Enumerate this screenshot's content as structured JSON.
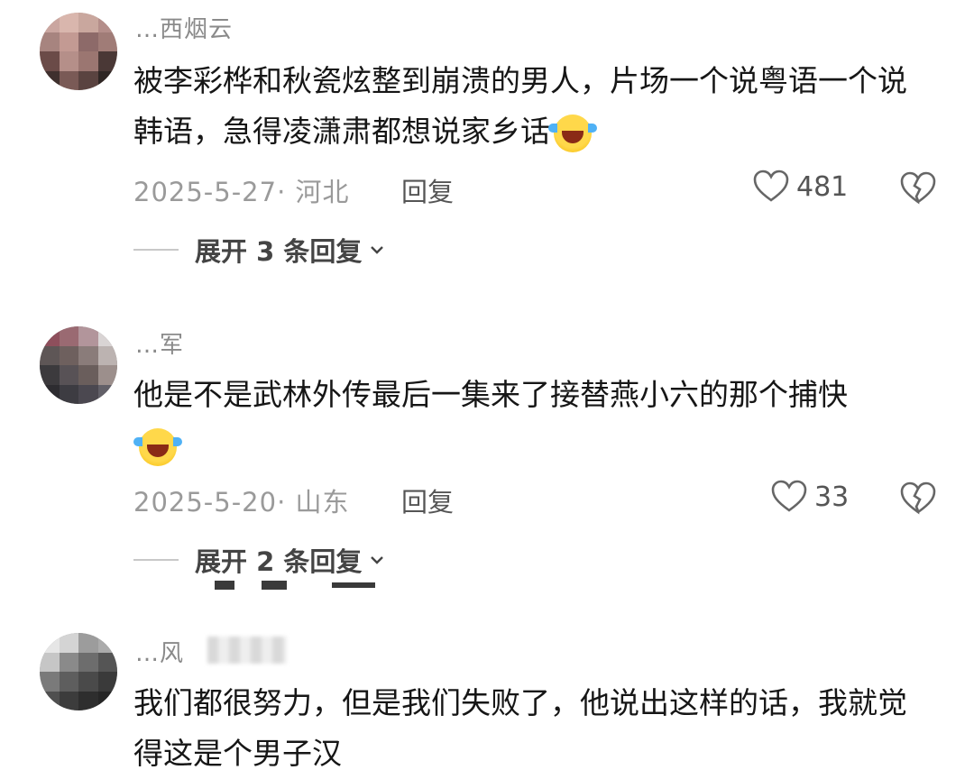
{
  "comments": [
    {
      "username": "…西烟云",
      "text": "被李彩桦和秋瓷炫整到崩溃的男人，片场一个说粤语一个说韩语，急得凌潇肃都想说家乡话",
      "date_location": "2025-5-27· 河北",
      "reply_label": "回复",
      "likes": "481",
      "expand_label": "展开 3 条回复",
      "has_emoji": true,
      "emoji_name": "laughing-crying-emoji"
    },
    {
      "username": "…军",
      "text": "他是不是武林外传最后一集来了接替燕小六的那个捕快",
      "date_location": "2025-5-20· 山东",
      "reply_label": "回复",
      "likes": "33",
      "expand_label": "展开 2 条回复",
      "has_emoji": true,
      "emoji_name": "laughing-crying-emoji"
    },
    {
      "username": "…风",
      "text": "我们都很努力，但是我们失败了，他说出这样的话，我就觉得这是个男子汉",
      "has_emoji": false
    }
  ],
  "icons": {
    "like": "heart-outline-icon",
    "dislike": "broken-heart-icon",
    "expand": "chevron-down-icon"
  },
  "colors": {
    "text": "#161616",
    "meta": "#9a9a9a",
    "username": "#8a8a8a"
  }
}
